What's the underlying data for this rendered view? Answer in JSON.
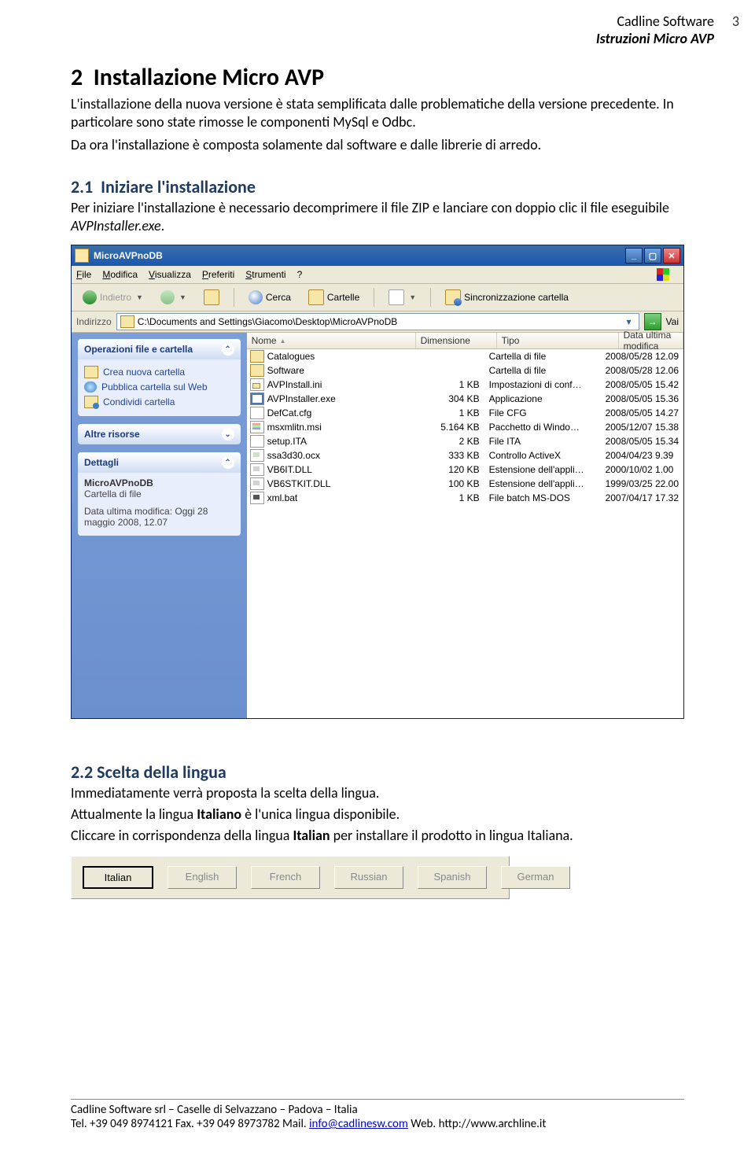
{
  "header": {
    "brand": "Cadline Software",
    "sub": "Istruzioni Micro AVP",
    "page_number": "3"
  },
  "section2": {
    "number": "2",
    "title": "Installazione Micro AVP",
    "paragraph": "L'installazione della nuova versione è stata semplificata dalle problematiche della versione precedente. In particolare sono state rimosse le componenti MySql e Odbc.",
    "paragraph2": "Da ora l'installazione è composta solamente dal software e dalle librerie di arredo."
  },
  "section21": {
    "number": "2.1",
    "title": "Iniziare l'installazione",
    "p1_pre": "Per iniziare l'installazione è necessario decomprimere il file ZIP e lanciare con doppio clic il file eseguibile ",
    "p1_em": "AVPInstaller.exe",
    "p1_post": "."
  },
  "explorer": {
    "title": "MicroAVPnoDB",
    "menus": {
      "file": "File",
      "modifica": "Modifica",
      "visualizza": "Visualizza",
      "preferiti": "Preferiti",
      "strumenti": "Strumenti",
      "help": "?"
    },
    "toolbar": {
      "back": "Indietro",
      "search": "Cerca",
      "folders": "Cartelle",
      "sync": "Sincronizzazione cartella"
    },
    "address": {
      "label": "Indirizzo",
      "path": "C:\\Documents and Settings\\Giacomo\\Desktop\\MicroAVPnoDB",
      "go": "Vai"
    },
    "sidepane": {
      "ops_title": "Operazioni file e cartella",
      "ops": [
        "Crea nuova cartella",
        "Pubblica cartella sul Web",
        "Condividi cartella"
      ],
      "other_title": "Altre risorse",
      "details_title": "Dettagli",
      "details": {
        "name": "MicroAVPnoDB",
        "type": "Cartella di file",
        "mod": "Data ultima modifica: Oggi 28 maggio 2008, 12.07"
      }
    },
    "columns": {
      "name": "Nome",
      "size": "Dimensione",
      "type": "Tipo",
      "date": "Data ultima modifica"
    },
    "files": [
      {
        "icon": "fi-folder",
        "name": "Catalogues",
        "size": "",
        "type": "Cartella di file",
        "date": "2008/05/28 12.09"
      },
      {
        "icon": "fi-folder",
        "name": "Software",
        "size": "",
        "type": "Cartella di file",
        "date": "2008/05/28 12.06"
      },
      {
        "icon": "fi-ini",
        "name": "AVPInstall.ini",
        "size": "1 KB",
        "type": "Impostazioni di conf…",
        "date": "2008/05/05 15.42"
      },
      {
        "icon": "fi-exe",
        "name": "AVPInstaller.exe",
        "size": "304 KB",
        "type": "Applicazione",
        "date": "2008/05/05 15.36"
      },
      {
        "icon": "fi-cfg",
        "name": "DefCat.cfg",
        "size": "1 KB",
        "type": "File CFG",
        "date": "2008/05/05 14.27"
      },
      {
        "icon": "fi-msi",
        "name": "msxmlitn.msi",
        "size": "5.164 KB",
        "type": "Pacchetto di Windo…",
        "date": "2005/12/07 15.38"
      },
      {
        "icon": "fi-ita",
        "name": "setup.ITA",
        "size": "2 KB",
        "type": "File ITA",
        "date": "2008/05/05 15.34"
      },
      {
        "icon": "fi-ocx",
        "name": "ssa3d30.ocx",
        "size": "333 KB",
        "type": "Controllo ActiveX",
        "date": "2004/04/23 9.39"
      },
      {
        "icon": "fi-dll",
        "name": "VB6IT.DLL",
        "size": "120 KB",
        "type": "Estensione dell'appli…",
        "date": "2000/10/02 1.00"
      },
      {
        "icon": "fi-dll",
        "name": "VB6STKIT.DLL",
        "size": "100 KB",
        "type": "Estensione dell'appli…",
        "date": "1999/03/25 22.00"
      },
      {
        "icon": "fi-bat",
        "name": "xml.bat",
        "size": "1 KB",
        "type": "File batch MS-DOS",
        "date": "2007/04/17 17.32"
      }
    ]
  },
  "section22": {
    "number": "2.2",
    "title": "Scelta della lingua",
    "p1": "Immediatamente verrà proposta la scelta della lingua.",
    "p2_pre": "Attualmente la lingua ",
    "p2_bold": "Italiano",
    "p2_post": " è l'unica lingua disponibile.",
    "p3_pre": "Cliccare in corrispondenza della lingua ",
    "p3_bold": "Italian",
    "p3_post": " per installare il prodotto in lingua Italiana.",
    "langs": [
      "Italian",
      "English",
      "French",
      "Russian",
      "Spanish",
      "German"
    ]
  },
  "footer": {
    "line1": "Cadline Software srl – Caselle di Selvazzano – Padova – Italia",
    "line2_pre": "Tel. +39 049 8974121 Fax. +39 049 8973782 Mail. ",
    "mail": "info@cadlinesw.com",
    "line2_mid": " Web. ",
    "web": "http://www.archline.it"
  }
}
